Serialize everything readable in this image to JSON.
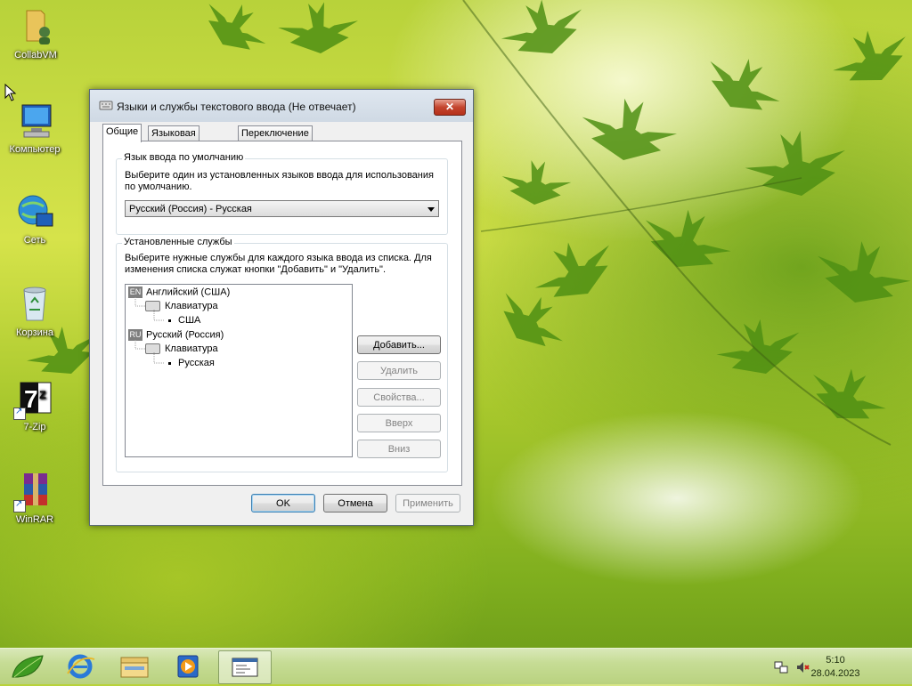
{
  "desktop": {
    "icons": [
      {
        "label": "CollabVM",
        "icon": "folder-user-icon"
      },
      {
        "label": "Компьютер",
        "icon": "computer-icon"
      },
      {
        "label": "Сеть",
        "icon": "network-icon"
      },
      {
        "label": "Корзина",
        "icon": "recycle-bin-icon"
      },
      {
        "label": "7-Zip",
        "icon": "7zip-icon"
      },
      {
        "label": "WinRAR",
        "icon": "winrar-icon"
      }
    ]
  },
  "dialog": {
    "title": "Языки и службы текстового ввода (Не отвечает)",
    "close_label": "✕",
    "tabs": [
      "Общие",
      "Языковая панель",
      "Переключение клавиатуры"
    ],
    "default_lang": {
      "group_label": "Язык ввода по умолчанию",
      "description": "Выберите один из установленных языков ввода для использования по умолчанию.",
      "selected": "Русский (Россия) - Русская"
    },
    "services": {
      "group_label": "Установленные службы",
      "description": "Выберите нужные службы для каждого языка ввода из списка. Для изменения списка служат кнопки \"Добавить\" и \"Удалить\".",
      "tree": [
        {
          "badge": "EN",
          "language": "Английский (США)",
          "category": "Клавиатура",
          "layout": "США"
        },
        {
          "badge": "RU",
          "language": "Русский (Россия)",
          "category": "Клавиатура",
          "layout": "Русская"
        }
      ],
      "buttons": {
        "add": "Добавить...",
        "remove": "Удалить",
        "properties": "Свойства...",
        "up": "Вверх",
        "down": "Вниз"
      }
    },
    "footer": {
      "ok": "OK",
      "cancel": "Отмена",
      "apply": "Применить"
    }
  },
  "taskbar": {
    "clock_time": "5:10",
    "clock_date": "28.04.2023"
  }
}
